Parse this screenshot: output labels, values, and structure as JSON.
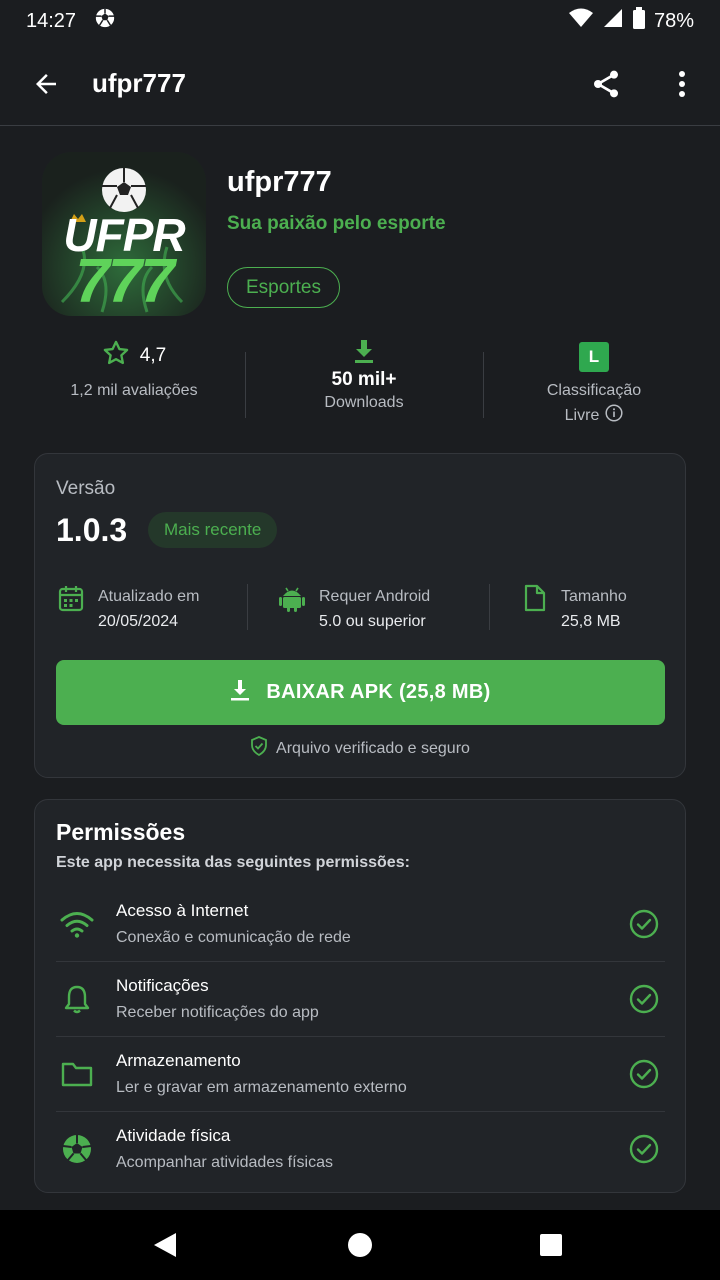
{
  "status_bar": {
    "time": "14:27",
    "battery": "78%",
    "icons": [
      "soccer-ball-icon",
      "wifi-icon",
      "signal-icon",
      "battery-icon"
    ]
  },
  "app_bar": {
    "title": "ufpr777",
    "icons": [
      "back-arrow-icon",
      "share-icon",
      "more-vert-icon"
    ]
  },
  "app": {
    "icon_line1": "UFPR",
    "icon_line2": "777",
    "name": "ufpr777",
    "tagline": "Sua paixão pelo esporte",
    "category": "Esportes"
  },
  "stats": {
    "rating": "4,7",
    "reviews": "1,2 mil avaliações",
    "downloads_value": "50 mil+",
    "downloads_label": "Downloads",
    "rating_badge": "L",
    "classification_label": "Classificação",
    "classification_value": "Livre"
  },
  "version": {
    "label": "Versão",
    "number": "1.0.3",
    "badge": "Mais recente",
    "updated_label": "Atualizado em",
    "updated_value": "20/05/2024",
    "android_label": "Requer Android",
    "android_value": "5.0 ou superior",
    "size_label": "Tamanho",
    "size_value": "25,8 MB",
    "download_button": "BAIXAR APK (25,8 MB)",
    "verified_text": "Arquivo verificado e seguro"
  },
  "permissions": {
    "title": "Permissões",
    "subtitle": "Este app necessita das seguintes permissões:",
    "items": [
      {
        "name": "Acesso à Internet",
        "desc": "Conexão e comunicação de rede",
        "icon": "wifi-icon"
      },
      {
        "name": "Notificações",
        "desc": "Receber notificações do app",
        "icon": "bell-icon"
      },
      {
        "name": "Armazenamento",
        "desc": "Ler e gravar em armazenamento externo",
        "icon": "folder-icon"
      },
      {
        "name": "Atividade física",
        "desc": "Acompanhar atividades físicas",
        "icon": "soccer-ball-icon"
      }
    ]
  },
  "colors": {
    "accent": "#4caf50",
    "background": "#1b1d20",
    "card": "#212428"
  }
}
